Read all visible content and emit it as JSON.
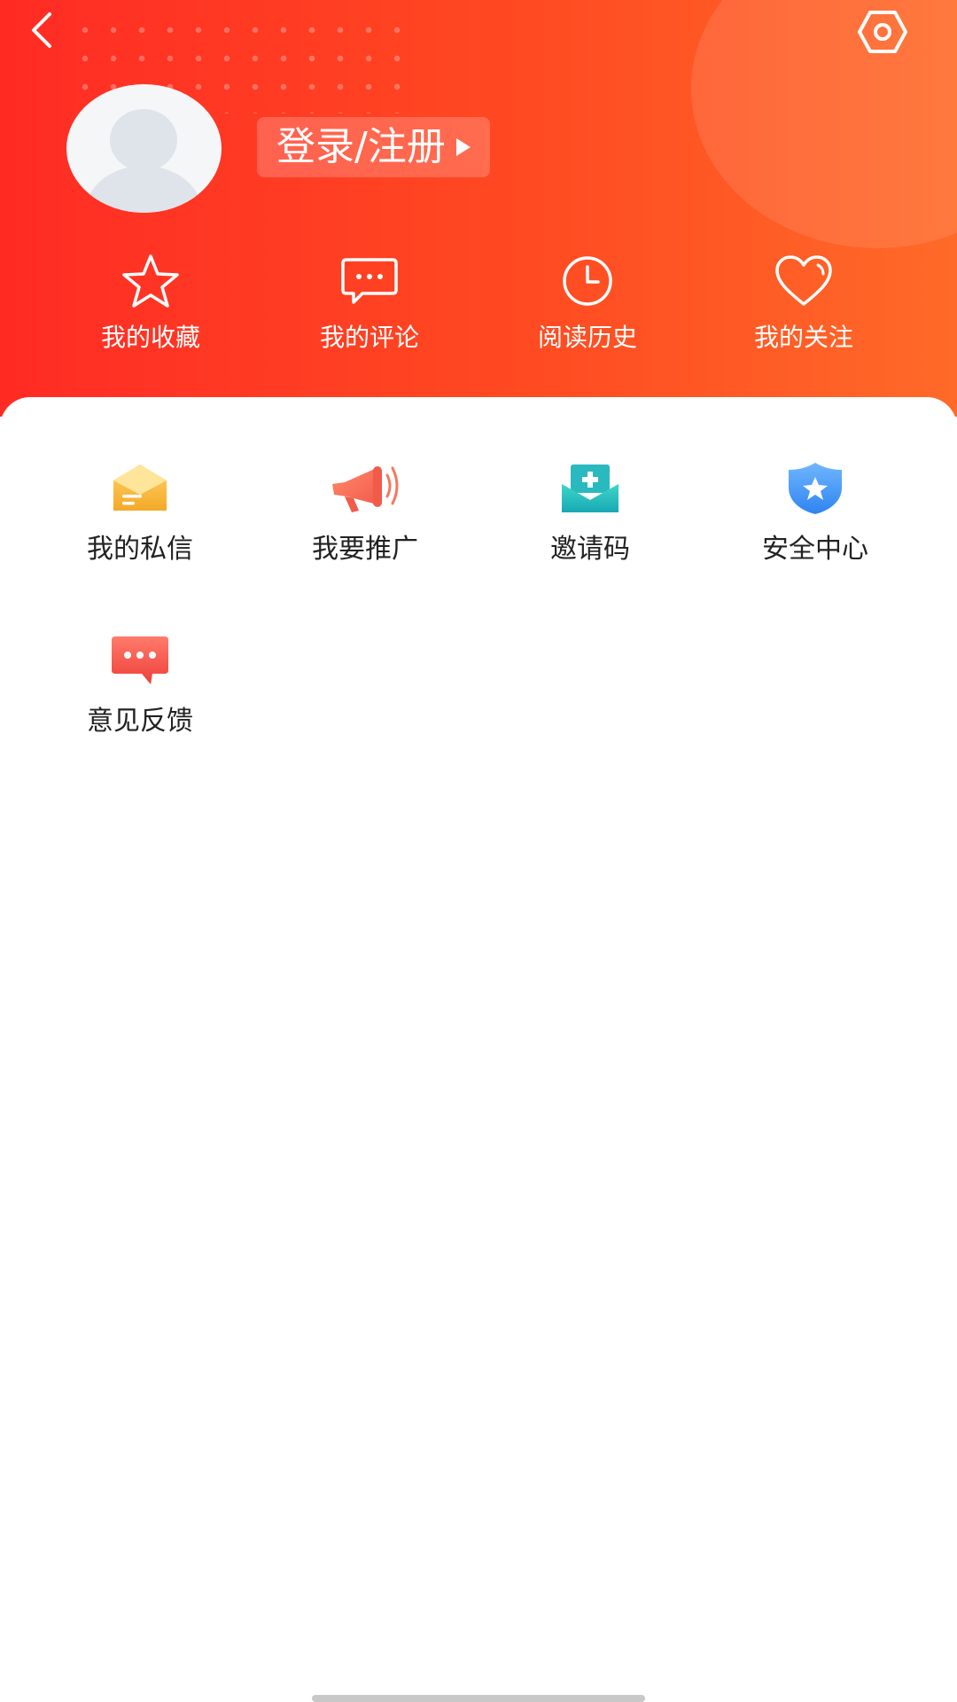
{
  "colors": {
    "header_start": "#ff2b24",
    "header_end": "#ff6a28",
    "text_dark": "#222222",
    "text_light": "#ffffff"
  },
  "header": {
    "back_icon": "chevron-left-icon",
    "settings_icon": "settings-hexagon-icon",
    "login_label": "登录/注册"
  },
  "quick_links": [
    {
      "label": "我的收藏",
      "icon": "star-icon"
    },
    {
      "label": "我的评论",
      "icon": "comment-icon"
    },
    {
      "label": "阅读历史",
      "icon": "clock-icon"
    },
    {
      "label": "我的关注",
      "icon": "heart-icon"
    }
  ],
  "menu": [
    {
      "label": "我的私信",
      "icon": "mail-icon"
    },
    {
      "label": "我要推广",
      "icon": "megaphone-icon"
    },
    {
      "label": "邀请码",
      "icon": "invite-icon"
    },
    {
      "label": "安全中心",
      "icon": "shield-icon"
    },
    {
      "label": "意见反馈",
      "icon": "feedback-icon"
    }
  ]
}
